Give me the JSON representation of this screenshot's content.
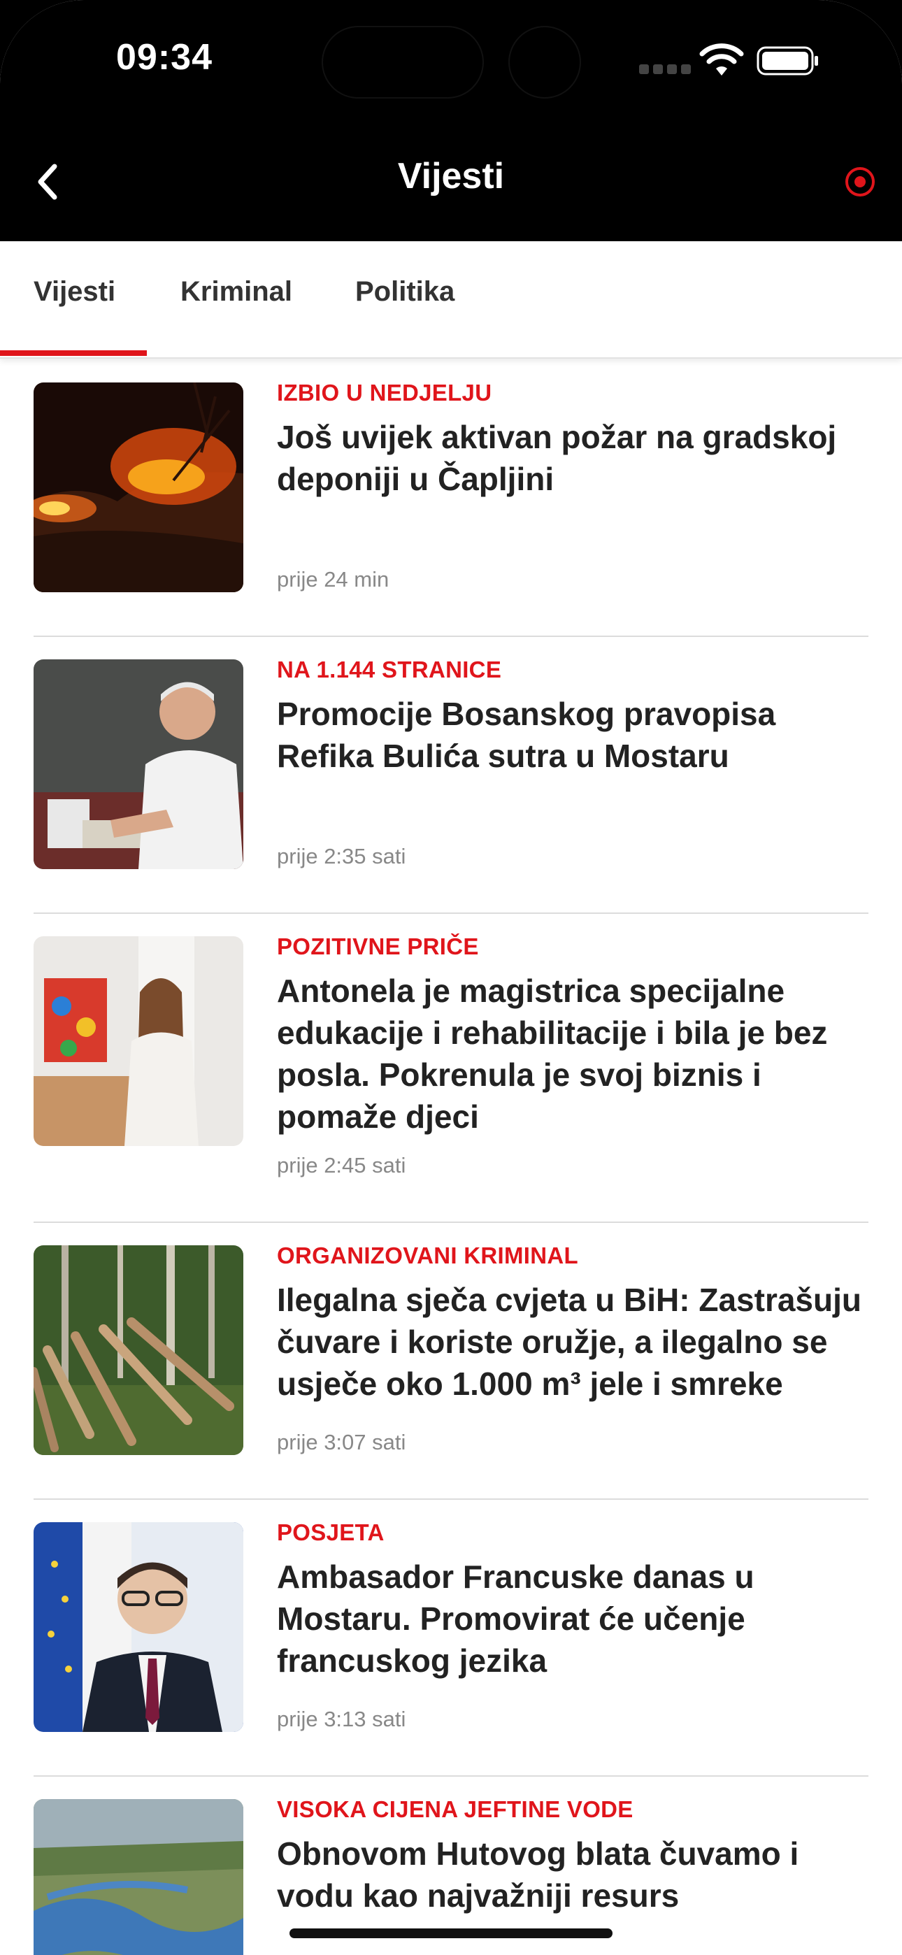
{
  "status": {
    "time": "09:34"
  },
  "nav": {
    "title": "Vijesti"
  },
  "tabs": [
    {
      "label": "Vijesti",
      "active": true
    },
    {
      "label": "Kriminal",
      "active": false
    },
    {
      "label": "Politika",
      "active": false
    }
  ],
  "articles": [
    {
      "kicker": "IZBIO U NEDJELJU",
      "title": "Još uvijek aktivan požar na gradskoj deponiji u Čapljini",
      "time": "prije 24 min"
    },
    {
      "kicker": "NA 1.144 STRANICE",
      "title": "Promocije Bosanskog pravopisa Refika Bulića sutra u Mostaru",
      "time": "prije 2:35 sati"
    },
    {
      "kicker": "POZITIVNE PRIČE",
      "title": "Antonela je magistrica specijalne edukacije i rehabilitacije i bila je bez posla. Pokrenula je svoj biznis i pomaže djeci",
      "time": "prije 2:45 sati"
    },
    {
      "kicker": "ORGANIZOVANI KRIMINAL",
      "title": "Ilegalna sječa cvjeta u BiH: Zastrašuju čuvare i koriste oružje, a ilegalno se usječe oko 1.000 m³ jele i smreke",
      "time": "prije 3:07 sati"
    },
    {
      "kicker": "POSJETA",
      "title": "Ambasador Francuske danas u Mostaru. Promovirat će učenje francuskog jezika",
      "time": "prije 3:13 sati"
    },
    {
      "kicker": "VISOKA CIJENA JEFTINE VODE",
      "title": "Obnovom Hutovog blata čuvamo i vodu kao najvažniji resurs",
      "time": ""
    }
  ],
  "colors": {
    "accent": "#e0151b",
    "header": "#000000"
  }
}
